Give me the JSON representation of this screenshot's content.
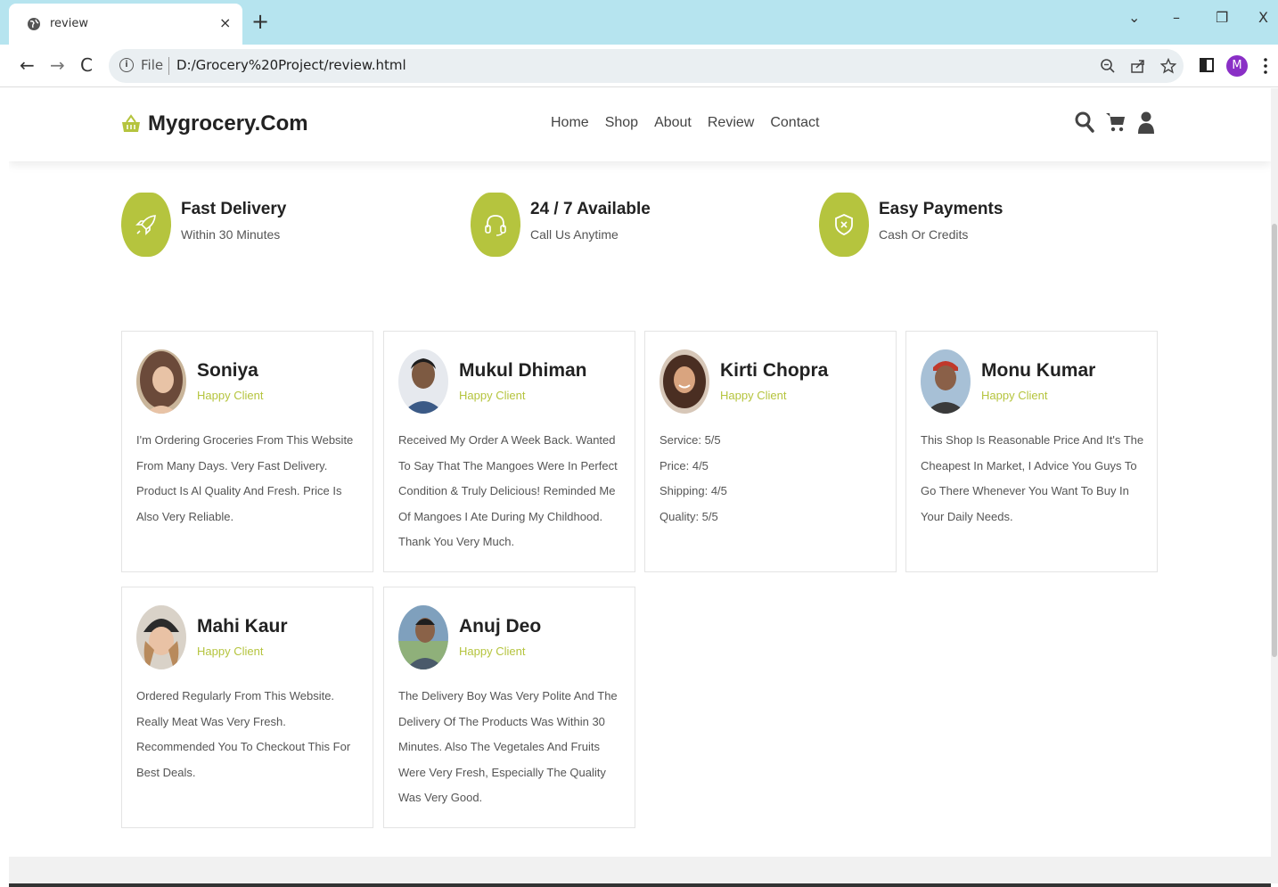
{
  "browser": {
    "tab_title": "review",
    "tab_close": "×",
    "new_tab": "+",
    "window_controls": [
      "⌄",
      "–",
      "❐",
      "X"
    ],
    "file_label": "File",
    "url": "D:/Grocery%20Project/review.html",
    "profile_initial": "M"
  },
  "header": {
    "logo_text": "Mygrocery.Com",
    "nav": [
      "Home",
      "Shop",
      "About",
      "Review",
      "Contact"
    ]
  },
  "features": [
    {
      "title": "Fast Delivery",
      "subtitle": "Within 30 Minutes",
      "icon": "rocket-icon"
    },
    {
      "title": "24 / 7 Available",
      "subtitle": "Call Us Anytime",
      "icon": "headphones-icon"
    },
    {
      "title": "Easy Payments",
      "subtitle": "Cash Or Credits",
      "icon": "shield-icon"
    }
  ],
  "reviews": [
    {
      "name": "Soniya",
      "role": "Happy Client",
      "text": "I'm Ordering Groceries From This Website From Many Days. Very Fast Delivery. Product Is Al Quality And Fresh. Price Is Also Very Reliable.",
      "avatar_color": "#6b4a3a"
    },
    {
      "name": "Mukul Dhiman",
      "role": "Happy Client",
      "text": "Received My Order A Week Back. Wanted To Say That The Mangoes Were In Perfect Condition & Truly Delicious! Reminded Me Of Mangoes I Ate During My Childhood. Thank You Very Much.",
      "avatar_color": "#3b5a86"
    },
    {
      "name": "Kirti Chopra",
      "role": "Happy Client",
      "text": "Service: 5/5\nPrice: 4/5\nShipping: 4/5\nQuality: 5/5",
      "avatar_color": "#5a3b2e"
    },
    {
      "name": "Monu Kumar",
      "role": "Happy Client",
      "text": "This Shop Is Reasonable Price And It's The Cheapest In Market, I Advice You Guys To Go There Whenever You Want To Buy In Your Daily Needs.",
      "avatar_color": "#6e6e6e"
    },
    {
      "name": "Mahi Kaur",
      "role": "Happy Client",
      "text": "Ordered Regularly From This Website. Really Meat Was Very Fresh. Recommended You To Checkout This For Best Deals.",
      "avatar_color": "#4a3a32"
    },
    {
      "name": "Anuj Deo",
      "role": "Happy Client",
      "text": "The Delivery Boy Was Very Polite And The Delivery Of The Products Was Within 30 Minutes. Also The Vegetales And Fruits Were Very Fresh, Especially The Quality Was Very Good.",
      "avatar_color": "#4a6b8a"
    }
  ],
  "colors": {
    "accent": "#b5c43e",
    "tabbar": "#b6e4ef"
  }
}
